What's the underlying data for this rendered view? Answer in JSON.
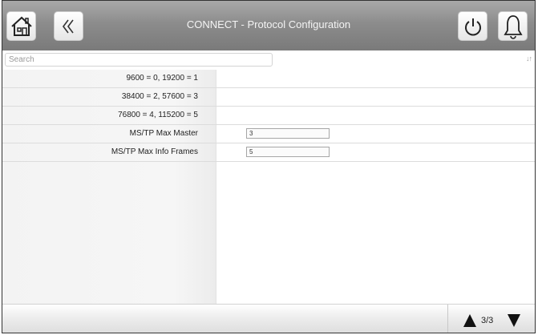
{
  "header": {
    "title": "CONNECT - Protocol Configuration",
    "home_icon": "home-icon",
    "back_icon": "double-chevron-left-icon",
    "power_icon": "power-icon",
    "alarm_icon": "bell-icon"
  },
  "search": {
    "placeholder": "Search",
    "value": "",
    "sort_icon": "sort-icon"
  },
  "rows": [
    {
      "label": "9600 = 0, 19200 = 1"
    },
    {
      "label": "38400 = 2, 57600 = 3"
    },
    {
      "label": "76800 = 4, 115200 = 5"
    },
    {
      "label": "MS/TP Max Master",
      "value": "3"
    },
    {
      "label": "MS/TP Max Info Frames",
      "value": "5"
    }
  ],
  "footer": {
    "page_indicator": "3/3",
    "up_icon": "triangle-up-icon",
    "down_icon": "triangle-down-icon"
  }
}
